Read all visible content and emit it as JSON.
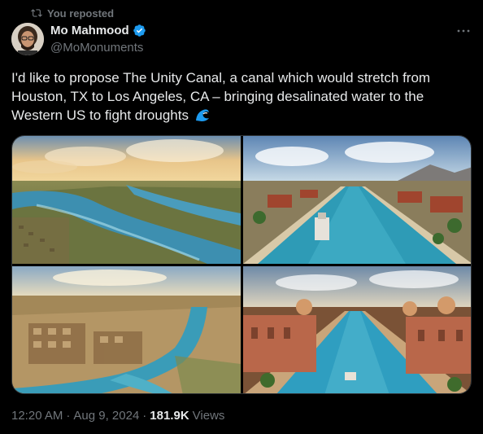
{
  "repost": {
    "label": "You reposted",
    "icon": "repost-icon"
  },
  "author": {
    "display_name": "Mo Mahmood",
    "handle": "@MoMonuments",
    "verified_color": "#1d9bf0"
  },
  "tweet": {
    "text": "I'd like to propose The Unity Canal, a canal which would stretch from Houston, TX to Los Angeles, CA – bringing desalinated water to the Western US to fight droughts",
    "emoji": "wave-icon"
  },
  "media": {
    "images": [
      {
        "name": "canal-aerial-sunset-image"
      },
      {
        "name": "canal-city-boats-image"
      },
      {
        "name": "canal-city-aerial-image"
      },
      {
        "name": "canal-palaces-image"
      }
    ]
  },
  "meta": {
    "time": "12:20 AM",
    "sep1": "·",
    "date": "Aug 9, 2024",
    "sep2": "·",
    "views_count": "181.9K",
    "views_label": "Views"
  },
  "colors": {
    "background": "#000000",
    "text": "#e7e9ea",
    "secondary": "#71767b",
    "accent": "#1d9bf0"
  }
}
